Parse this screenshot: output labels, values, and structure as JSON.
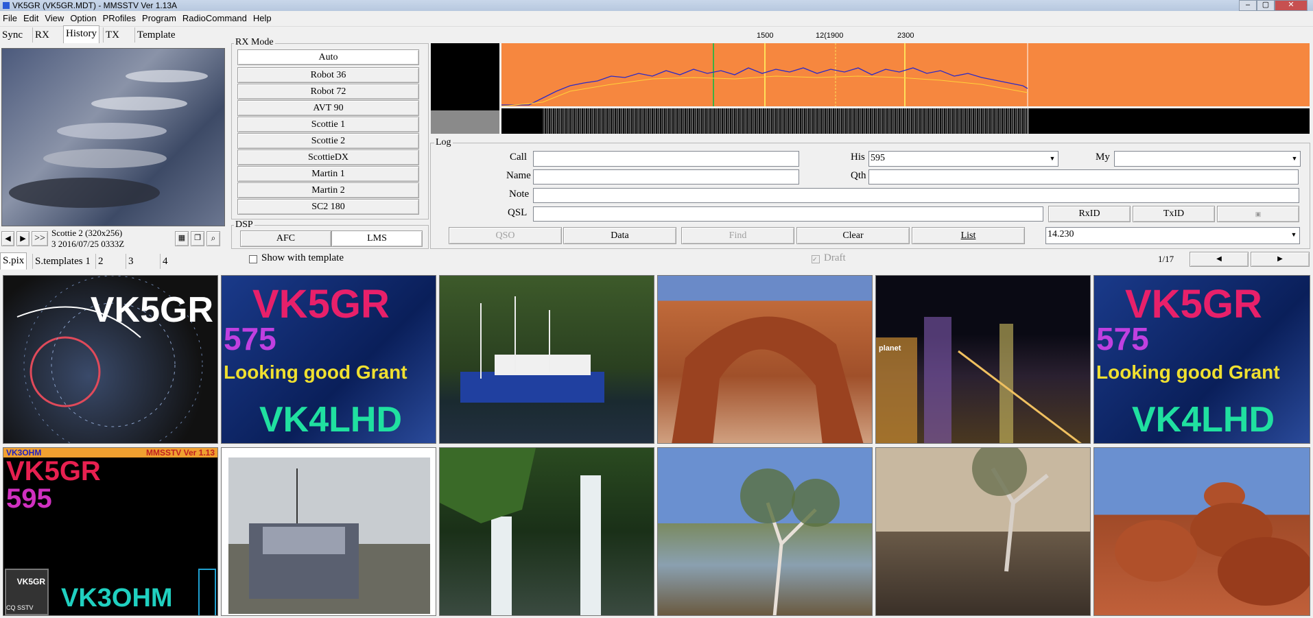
{
  "window": {
    "title": "VK5GR (VK5GR.MDT) - MMSSTV Ver 1.13A",
    "minimize": "–",
    "maximize": "▢",
    "close": "✕"
  },
  "menu": [
    "File",
    "Edit",
    "View",
    "Option",
    "PRofiles",
    "Program",
    "RadioCommand",
    "Help"
  ],
  "tabs": [
    "Sync",
    "RX",
    "History",
    "TX",
    "Template"
  ],
  "rx_mode": {
    "label": "RX Mode",
    "modes": [
      "Auto",
      "Robot 36",
      "Robot 72",
      "AVT 90",
      "Scottie 1",
      "Scottie 2",
      "ScottieDX",
      "Martin 1",
      "Martin 2",
      "SC2 180"
    ]
  },
  "dsp": {
    "label": "DSP",
    "afc": "AFC",
    "lms": "LMS"
  },
  "nav": {
    "prev": "◀",
    "next": "▶",
    "jump": ">>"
  },
  "rx_info": {
    "line1": "Scottie 2 (320x256)",
    "line2": "3 2016/07/25 0333Z"
  },
  "spectrum": {
    "tick_1500": "1500",
    "tick_1900": "12(1900",
    "tick_2300": "2300"
  },
  "log": {
    "label": "Log",
    "call_label": "Call",
    "name_label": "Name",
    "note_label": "Note",
    "qsl_label": "QSL",
    "his_label": "His",
    "his_value": "595",
    "qth_label": "Qth",
    "my_label": "My",
    "rxid": "RxID",
    "txid": "TxID",
    "qso": "QSO",
    "data": "Data",
    "find": "Find",
    "clear": "Clear",
    "list": "List",
    "freq": "14.230"
  },
  "bottom_tabs": [
    "S.pix",
    "S.templates 1",
    "2",
    "3",
    "4"
  ],
  "show_template": "Show with template",
  "draft": "Draft",
  "page": "1/17",
  "thumbs": {
    "t1_call": "VK5GR",
    "t2_call": "VK5GR",
    "t2_rst": "575",
    "t2_msg": "Looking good Grant",
    "t2_call2": "VK4LHD",
    "t6_call": "VK5GR",
    "t6_rst": "575",
    "t6_msg": "Looking good Grant",
    "t6_call2": "VK4LHD",
    "t7_header_left": "VK3OHM",
    "t7_header_right": "MMSSTV Ver 1.13",
    "t7_call": "VK5GR",
    "t7_rst": "595",
    "t7_small": "VK5GR",
    "t7_cq": "CQ SSTV",
    "t7_call2": "VK3OHM",
    "t5_sign": "planet"
  }
}
